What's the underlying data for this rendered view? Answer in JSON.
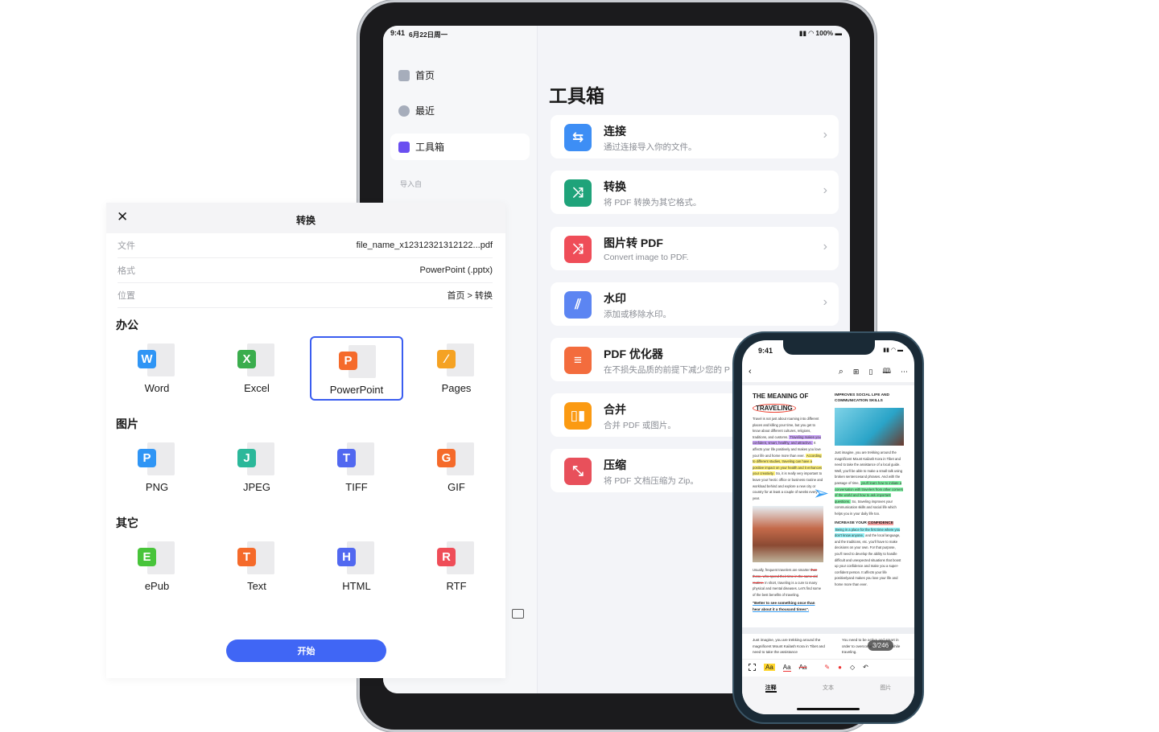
{
  "ipad": {
    "status": {
      "time": "9:41",
      "date": "6月22日周一",
      "battery": "100%"
    },
    "sidebar": {
      "items": [
        {
          "label": "首页",
          "icon": "home-icon"
        },
        {
          "label": "最近",
          "icon": "clock-icon"
        },
        {
          "label": "工具箱",
          "icon": "toolbox-icon",
          "active": true
        }
      ],
      "section": "导入自"
    },
    "title": "工具箱",
    "tools": [
      {
        "title": "连接",
        "subtitle": "通过连接导入你的文件。",
        "icon": "monitor-link-icon",
        "color": "#3d8ef5",
        "glyph": "⇆"
      },
      {
        "title": "转换",
        "subtitle": "将 PDF 转换为其它格式。",
        "icon": "convert-icon",
        "color": "#1fa37a",
        "glyph": "⤨"
      },
      {
        "title": "图片转 PDF",
        "subtitle": "Convert image to PDF.",
        "icon": "image-to-pdf-icon",
        "color": "#ef4d58",
        "glyph": "⤨"
      },
      {
        "title": "水印",
        "subtitle": "添加或移除水印。",
        "icon": "watermark-icon",
        "color": "#5c85f2",
        "glyph": "⫽"
      },
      {
        "title": "PDF 优化器",
        "subtitle": "在不损失品质的前提下减少您的 P",
        "icon": "optimizer-icon",
        "color": "#f36c3d",
        "glyph": "≡"
      },
      {
        "title": "合并",
        "subtitle": "合并 PDF 或图片。",
        "icon": "merge-icon",
        "color": "#fb9a12",
        "glyph": "▯▮"
      },
      {
        "title": "压缩",
        "subtitle": "将 PDF 文档压缩为 Zip。",
        "icon": "compress-icon",
        "color": "#e8505b",
        "glyph": "⤡"
      }
    ]
  },
  "modal": {
    "title": "转换",
    "rows": [
      {
        "key": "文件",
        "value": "file_name_x12312321312122...pdf"
      },
      {
        "key": "格式",
        "value": "PowerPoint (.pptx)"
      },
      {
        "key": "位置",
        "value": "首页 > 转换"
      }
    ],
    "sections": [
      {
        "title": "办公",
        "formats": [
          {
            "label": "Word",
            "letter": "W",
            "color": "#2f95f5"
          },
          {
            "label": "Excel",
            "letter": "X",
            "color": "#3aad4d"
          },
          {
            "label": "PowerPoint",
            "letter": "P",
            "color": "#f56a2a",
            "selected": true
          },
          {
            "label": "Pages",
            "letter": "∕",
            "color": "#f5a223"
          }
        ]
      },
      {
        "title": "图片",
        "formats": [
          {
            "label": "PNG",
            "letter": "P",
            "color": "#2f95f5"
          },
          {
            "label": "JPEG",
            "letter": "J",
            "color": "#2bb89a"
          },
          {
            "label": "TIFF",
            "letter": "T",
            "color": "#5168f0"
          },
          {
            "label": "GIF",
            "letter": "G",
            "color": "#f56a2a"
          }
        ]
      },
      {
        "title": "其它",
        "formats": [
          {
            "label": "ePub",
            "letter": "E",
            "color": "#48c43a"
          },
          {
            "label": "Text",
            "letter": "T",
            "color": "#f56a2a"
          },
          {
            "label": "HTML",
            "letter": "H",
            "color": "#5168f0"
          },
          {
            "label": "RTF",
            "letter": "R",
            "color": "#ef4d58"
          }
        ]
      }
    ],
    "start": "开始"
  },
  "phone": {
    "time": "9:41",
    "doc": {
      "title": "THE MEANING OF",
      "title2": "TRAVELING",
      "left_paragraphs": [
        [
          {
            "t": "Travel is not just about roaming into different places and killing your time, but you get to know about different cultures, religions, traditions, and customs. "
          },
          {
            "t": "Traveling makes you confident, smart, healthy, and attractive.",
            "h": "#c9a3f7"
          },
          {
            "t": " It affects your life positively and makes you love your life and home more than ever. "
          },
          {
            "t": "According to different studies, traveling can have a positive impact on your health and it enhances your creativity.",
            "h": "#fff27a"
          },
          {
            "t": " So, it is really very important to leave your hectic office or business routine and workload behind and explore a new city or country for at least a couple of weeks every year."
          }
        ],
        [
          {
            "t": "Usually, frequent travelers are smarter "
          },
          {
            "t": "than those, who spend their time in the same old routine.",
            "s": true
          },
          {
            "t": " In short, traveling is a cure to many physical and mental diseases. Let's find some of the best benefits of traveling."
          }
        ]
      ],
      "quote": "\"Better to see something once than hear about it a thousand times\".",
      "right_heading": "IMPROVES SOCIAL LIFE AND COMMUNICATION SKILLS",
      "right_paragraphs": [
        [
          {
            "t": "Just imagine, you are trekking around the magnificent Mount Kailash Kora in Tibet and need to take the assistance of a local guide. Well, you'll be able to make a small talk using broken sentencesand phrases. And with the passage of time, "
          },
          {
            "t": "you'll learn how to initiate a conversation with travelers from other corners of the world and how to ask important questions.",
            "h": "#7ef0a2"
          },
          {
            "t": " So, traveling improves your communication skills and social life which helps you in your daily life too."
          }
        ]
      ],
      "right_heading2": "INCREASE YOUR",
      "right_heading2_hl": "CONFIDENCE",
      "right_paragraphs2": [
        [
          {
            "t": "Being in a place for the first time where you don't know anyone,",
            "h": "#8ff0f5"
          },
          {
            "t": " and the local language, and the traditions, etc. you'll have to make decisions on your own. For that purpose, you'll need to develop the ability to handle difficult and unexpected situations that boost up your confidence and make you a super- confident person. It affects your life positivelyand makes you love your life and home more than ever."
          }
        ]
      ],
      "next_left": "Just imagine, you are trekking around the magnificent Mount Kailash Kora in Tibet and need to take the assistance",
      "next_right": "You need to be active and smart in order to overcome challenges while traveling."
    },
    "page_indicator": "3/246",
    "tabs": [
      {
        "label": "注释",
        "active": true
      },
      {
        "label": "文本"
      },
      {
        "label": "图片"
      }
    ],
    "tool_labels": {
      "highlight": "Aa",
      "underline": "Aa",
      "strike": "Aa"
    }
  }
}
